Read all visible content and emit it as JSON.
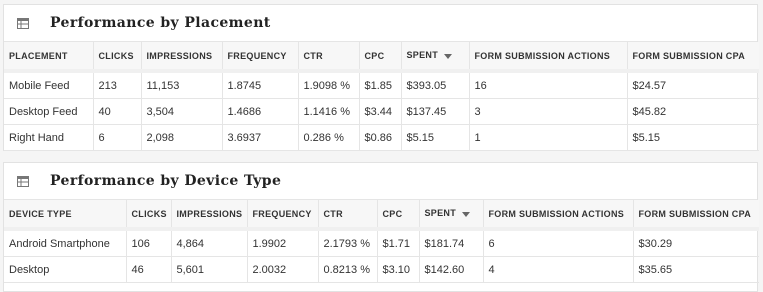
{
  "placement": {
    "title": "Performance by Placement",
    "icon": "table-icon",
    "columns": [
      "PLACEMENT",
      "CLICKS",
      "IMPRESSIONS",
      "FREQUENCY",
      "CTR",
      "CPC",
      "SPENT",
      "FORM SUBMISSION ACTIONS",
      "FORM SUBMISSION CPA"
    ],
    "sort_column": "SPENT",
    "sort_icon": "sort-desc-icon",
    "rows": [
      [
        "Mobile Feed",
        "213",
        "11,153",
        "1.8745",
        "1.9098 %",
        "$1.85",
        "$393.05",
        "16",
        "$24.57"
      ],
      [
        "Desktop Feed",
        "40",
        "3,504",
        "1.4686",
        "1.1416 %",
        "$3.44",
        "$137.45",
        "3",
        "$45.82"
      ],
      [
        "Right Hand",
        "6",
        "2,098",
        "3.6937",
        "0.286 %",
        "$0.86",
        "$5.15",
        "1",
        "$5.15"
      ]
    ]
  },
  "device": {
    "title": "Performance by Device Type",
    "icon": "table-icon",
    "columns": [
      "DEVICE TYPE",
      "CLICKS",
      "IMPRESSIONS",
      "FREQUENCY",
      "CTR",
      "CPC",
      "SPENT",
      "FORM SUBMISSION ACTIONS",
      "FORM SUBMISSION CPA"
    ],
    "sort_column": "SPENT",
    "sort_icon": "sort-desc-icon",
    "rows": [
      [
        "Android Smartphone",
        "106",
        "4,864",
        "1.9902",
        "2.1793 %",
        "$1.71",
        "$181.74",
        "6",
        "$30.29"
      ],
      [
        "Desktop",
        "46",
        "5,601",
        "2.0032",
        "0.8213 %",
        "$3.10",
        "$142.60",
        "4",
        "$35.65"
      ]
    ]
  }
}
